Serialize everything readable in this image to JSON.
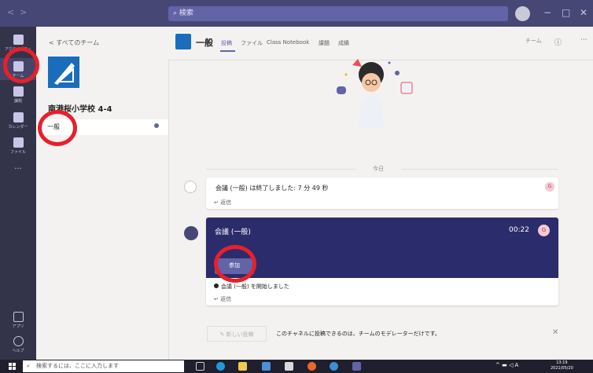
{
  "titlebar": {
    "search_placeholder": "検索",
    "back_arrow": "<",
    "forward_arrow": ">",
    "minimize": "−",
    "maximize": "□",
    "close": "✕"
  },
  "rail": {
    "items": [
      {
        "label": "アクティビティ",
        "icon": "bell-icon"
      },
      {
        "label": "チーム",
        "icon": "teams-icon"
      },
      {
        "label": "課題",
        "icon": "assignments-icon"
      },
      {
        "label": "カレンダー",
        "icon": "calendar-icon"
      },
      {
        "label": "ファイル",
        "icon": "file-icon"
      }
    ],
    "more": "···",
    "apps_label": "アプリ",
    "help_label": "ヘルプ"
  },
  "leftpane": {
    "back_label": "< すべてのチーム",
    "team_name": "南港桜小学校 4-4",
    "channel": "一般"
  },
  "header": {
    "channel_title": "一般",
    "tabs": [
      "投稿",
      "ファイル",
      "Class Notebook",
      "課題",
      "成績"
    ],
    "team_button": "チーム",
    "info": "ⓘ",
    "more": "···"
  },
  "feed": {
    "date_divider": "今日",
    "card1": {
      "text": "会議 (一般) は終了しました: 7 分 49 秒",
      "reply": "返信",
      "avatar": "G"
    },
    "meeting": {
      "title": "会議 (一般)",
      "time": "00:22",
      "avatar": "G",
      "join_button": "参加",
      "started_text": "会議 (一般) を開始しました",
      "reply": "返信"
    }
  },
  "compose": {
    "new_post": "新しい投稿",
    "moderation_notice": "このチャネルに投稿できるのは、チームのモデレーターだけです。",
    "close": "✕"
  },
  "taskbar": {
    "search_placeholder": "検索するには、ここに入力します",
    "time": "13:19",
    "date": "2021/05/20",
    "ime": "A"
  },
  "colors": {
    "teams_purple": "#6264a7",
    "rail": "#33344a",
    "meeting_banner": "#2b2c6b",
    "annotation_red": "#e8202a"
  }
}
